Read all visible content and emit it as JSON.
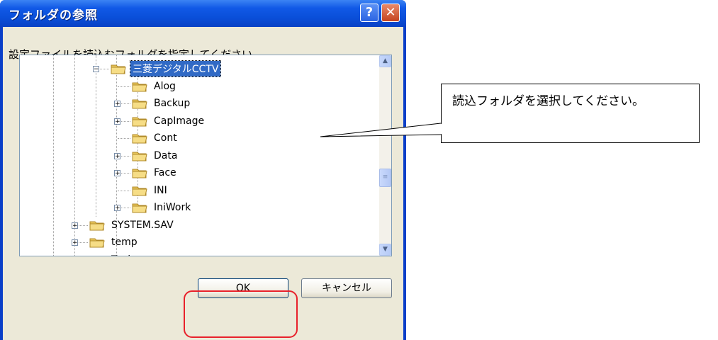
{
  "dialog": {
    "title": "フォルダの参照",
    "help_glyph": "?",
    "close_glyph": "✕",
    "prompt": "設定ファイルを読込むフォルダを指定してください。"
  },
  "tree": {
    "items": [
      {
        "label": "三菱デジタルCCTV",
        "expander": "−",
        "selected": true
      },
      {
        "label": "Alog",
        "expander": ""
      },
      {
        "label": "Backup",
        "expander": "+"
      },
      {
        "label": "CapImage",
        "expander": "+"
      },
      {
        "label": "Cont",
        "expander": ""
      },
      {
        "label": "Data",
        "expander": "+"
      },
      {
        "label": "Face",
        "expander": "+"
      },
      {
        "label": "INI",
        "expander": ""
      },
      {
        "label": "IniWork",
        "expander": "+"
      },
      {
        "label": "SYSTEM.SAV",
        "expander": "+"
      },
      {
        "label": "temp",
        "expander": "+"
      },
      {
        "label": "Tool",
        "expander": "+"
      }
    ]
  },
  "scrollbar": {
    "up_glyph": "▲",
    "down_glyph": "▼",
    "thumb_glyph": "≡"
  },
  "buttons": {
    "ok": "OK",
    "cancel": "キャンセル"
  },
  "callout": {
    "text": "読込フォルダを選択してください。"
  },
  "colors": {
    "title_bar": "#0a4fd9",
    "selection": "#316ac5",
    "highlight_outline": "#e8212b"
  }
}
